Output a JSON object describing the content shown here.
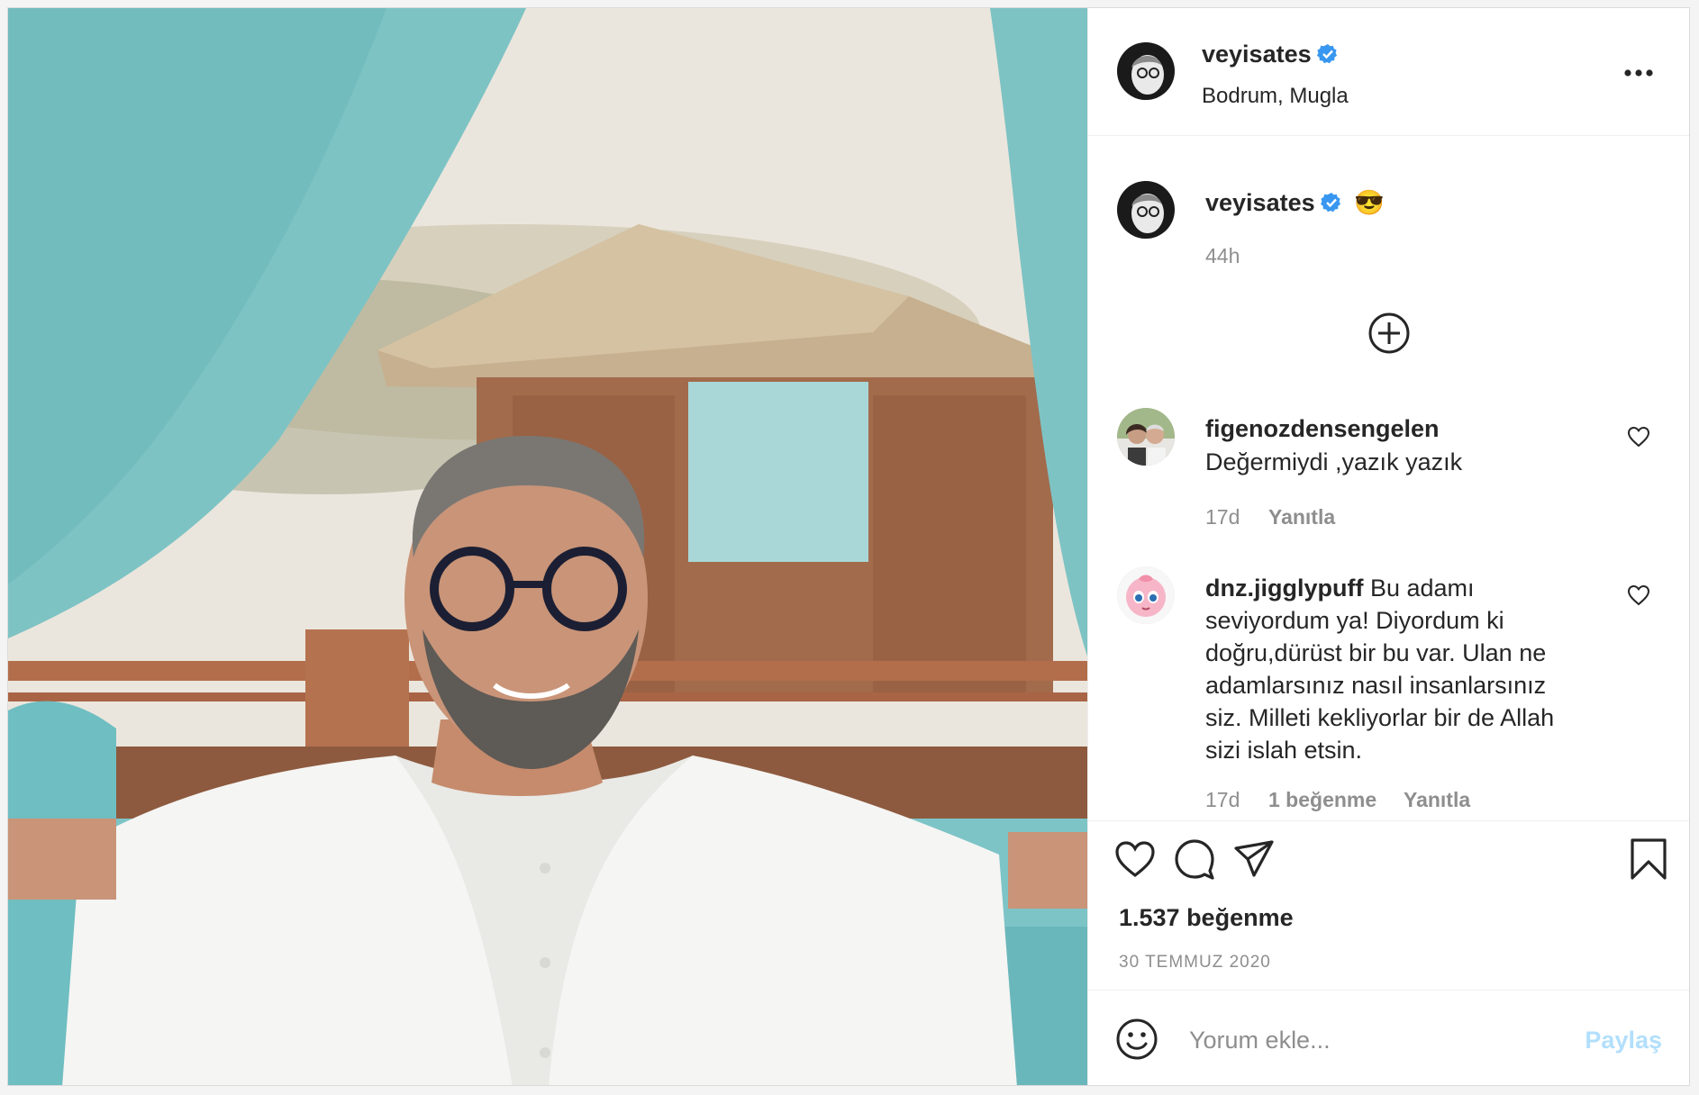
{
  "post": {
    "author": "veyisates",
    "location": "Bodrum, Mugla",
    "caption": {
      "username": "veyisates",
      "emoji": "😎",
      "time": "44h"
    },
    "comments": [
      {
        "username": "figenozdensengelen",
        "text": "Değermiydi ,yazık yazık",
        "time": "17d",
        "reply_label": "Yanıtla"
      },
      {
        "username": "dnz.jigglypuff",
        "text_lines": [
          "Bu adamı",
          "seviyordum ya! Diyordum ki",
          "doğru,dürüst bir bu var. Ulan ne",
          "adamlarsınız nasıl insanlarsınız",
          "siz. Milleti kekliyorlar bir de Allah",
          "sizi islah etsin."
        ],
        "time": "17d",
        "likes_label": "1 beğenme",
        "reply_label": "Yanıtla"
      }
    ],
    "likes": "1.537 beğenme",
    "date": "30 TEMMUZ 2020",
    "comment_placeholder": "Yorum ekle...",
    "share_label": "Paylaş"
  },
  "icons": {
    "verified": "verified-badge-icon",
    "more": "more-options-icon",
    "load_more": "plus-circle-icon",
    "like": "heart-icon",
    "comment": "comment-icon",
    "share": "paper-plane-icon",
    "save": "bookmark-icon",
    "emoji": "smiley-icon"
  },
  "colors": {
    "verified_blue": "#3897f0",
    "share_disabled": "#b2dffc",
    "secondary_text": "#8e8e8e",
    "curtain_teal": "#7ec3c4"
  }
}
